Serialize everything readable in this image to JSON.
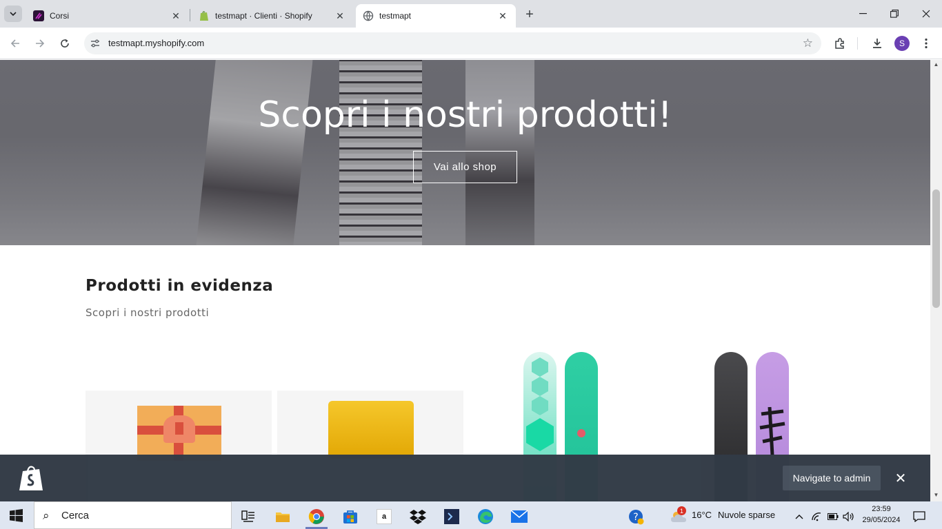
{
  "browser": {
    "tabs": [
      {
        "title": "Corsi",
        "active": false
      },
      {
        "title": "testmapt · Clienti · Shopify",
        "active": false
      },
      {
        "title": "testmapt",
        "active": true
      }
    ],
    "url": "testmapt.myshopify.com"
  },
  "hero": {
    "title": "Scopri i nostri prodotti!",
    "button_label": "Vai allo shop"
  },
  "featured": {
    "title": "Prodotti in evidenza",
    "subtitle": "Scopri i nostri prodotti"
  },
  "admin_bar": {
    "button_label": "Navigate to admin"
  },
  "profile_initial": "S",
  "taskbar": {
    "search_placeholder": "Cerca",
    "amazon_label": "a",
    "weather_badge": "1",
    "temperature": "16°C",
    "weather": "Nuvole sparse",
    "time": "23:59",
    "date": "29/05/2024"
  },
  "colors": {
    "chrome_tabstrip": "#dfe1e5",
    "admin_bar": "#323b46",
    "taskbar": "#dfe6f1"
  }
}
